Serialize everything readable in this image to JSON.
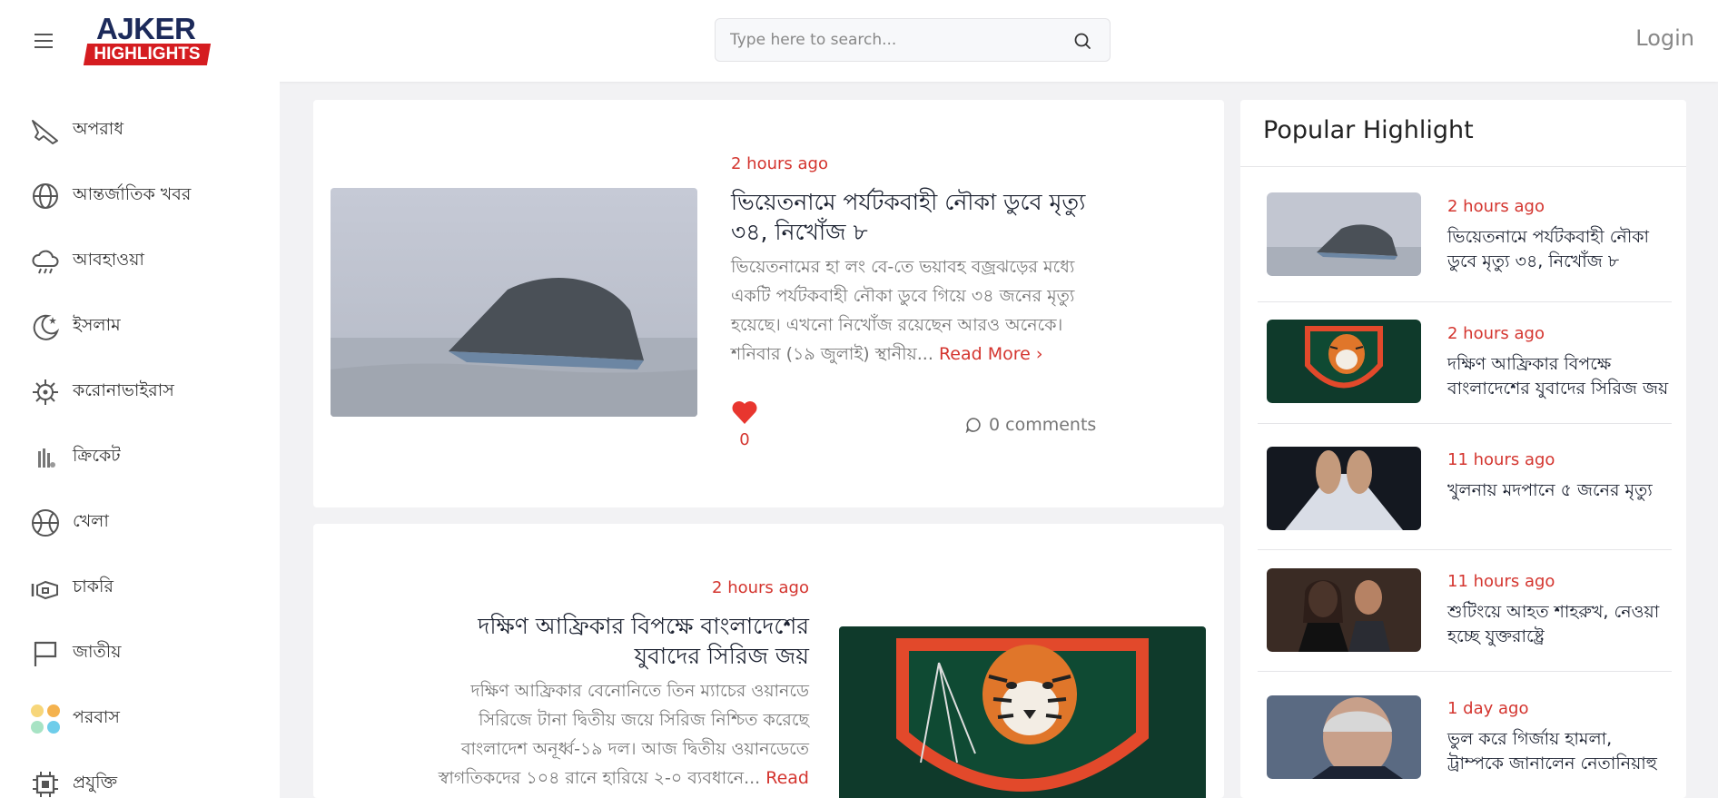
{
  "header": {
    "logo_top": "AJKER",
    "logo_bottom": "HIGHLIGHTS",
    "search_placeholder": "Type here to search...",
    "login_label": "Login"
  },
  "sidebar": {
    "items": [
      {
        "label": "অপরাধ",
        "icon": "knife-icon"
      },
      {
        "label": "আন্তর্জাতিক খবর",
        "icon": "globe-icon"
      },
      {
        "label": "আবহাওয়া",
        "icon": "cloud-rain-icon"
      },
      {
        "label": "ইসলাম",
        "icon": "moon-star-icon"
      },
      {
        "label": "করোনাভাইরাস",
        "icon": "virus-icon"
      },
      {
        "label": "ক্রিকেট",
        "icon": "cricket-icon"
      },
      {
        "label": "খেলা",
        "icon": "ball-icon"
      },
      {
        "label": "চাকরি",
        "icon": "briefcase-icon"
      },
      {
        "label": "জাতীয়",
        "icon": "flag-icon"
      },
      {
        "label": "পরবাস",
        "icon": "circles-icon"
      },
      {
        "label": "প্রযুক্তি",
        "icon": "chip-icon"
      }
    ]
  },
  "feed": {
    "articles": [
      {
        "time": "2 hours ago",
        "title": "ভিয়েতনামে পর্যটকবাহী নৌকা ডুবে মৃত্যু ৩৪, নিখোঁজ ৮",
        "excerpt_lines": [
          "ভিয়েতনামের হা লং বে-তে ভয়াবহ বজ্রঝড়ের মধ্যে",
          "একটি পর্যটকবাহী নৌকা ডুবে গিয়ে ৩৪ জনের মৃত্যু",
          "হয়েছে। এখনো নিখোঁজ রয়েছেন আরও অনেকে।",
          "শনিবার (১৯ জুলাই) স্থানীয়..."
        ],
        "read_more": "Read More",
        "likes": "0",
        "comments": "0 comments"
      },
      {
        "time": "2 hours ago",
        "title_lines": [
          "দক্ষিণ আফ্রিকার বিপক্ষে বাংলাদেশের",
          "যুবাদের সিরিজ জয়"
        ],
        "excerpt_lines": [
          "দক্ষিণ আফ্রিকার বেনোনিতে তিন ম্যাচের ওয়ানডে",
          "সিরিজে টানা দ্বিতীয় জয়ে সিরিজ নিশ্চিত করেছে",
          "বাংলাদেশ অনূর্ধ্ব-১৯ দল। আজ দ্বিতীয় ওয়ানডেতে",
          "স্বাগতিকদের ১০৪ রানে হারিয়ে ২-০ ব্যবধানে..."
        ],
        "read_more": "Read"
      }
    ]
  },
  "popular": {
    "heading": "Popular Highlight",
    "items": [
      {
        "time": "2 hours ago",
        "title_lines": [
          "ভিয়েতনামে পর্যটকবাহী নৌকা",
          "ডুবে মৃত্যু ৩৪, নিখোঁজ ৮"
        ]
      },
      {
        "time": "2 hours ago",
        "title_lines": [
          "দক্ষিণ আফ্রিকার বিপক্ষে",
          "বাংলাদেশের যুবাদের সিরিজ জয়"
        ]
      },
      {
        "time": "11 hours ago",
        "title_lines": [
          "খুলনায় মদপানে ৫ জনের মৃত্যু",
          ""
        ]
      },
      {
        "time": "11 hours ago",
        "title_lines": [
          "শুটিংয়ে আহত শাহরুখ, নেওয়া",
          "হচ্ছে যুক্তরাষ্ট্রে"
        ]
      },
      {
        "time": "1 day ago",
        "title_lines": [
          "ভুল করে গির্জায় হামলা,",
          "ট্রাম্পকে জানালেন নেতানিয়াহু"
        ]
      }
    ]
  },
  "colors": {
    "accent": "#d4352f",
    "brand_navy": "#1c2a5a",
    "brand_red": "#d51c20",
    "heart": "#e8362f"
  }
}
